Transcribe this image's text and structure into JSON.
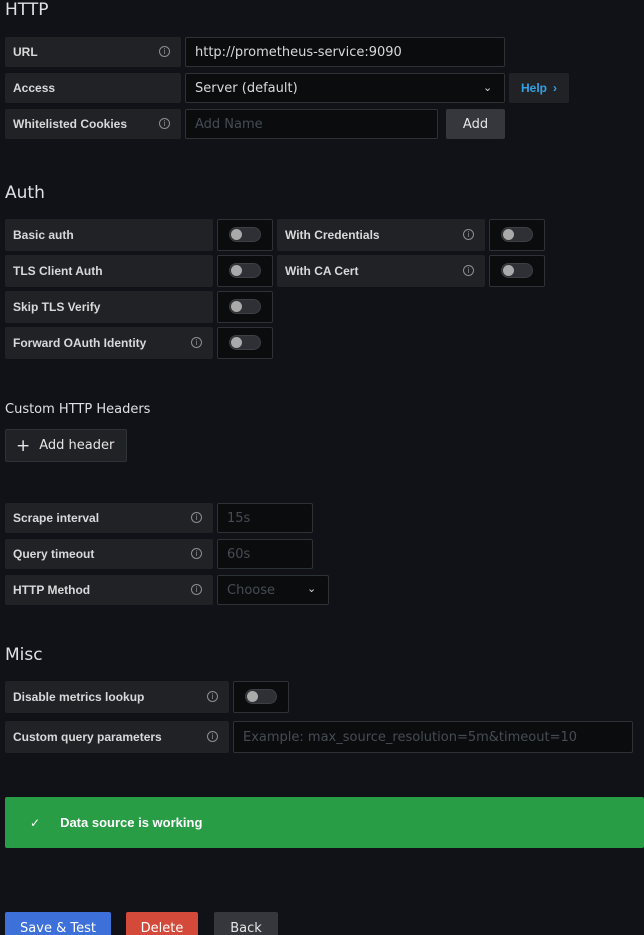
{
  "http": {
    "title": "HTTP",
    "url_label": "URL",
    "url_value": "http://prometheus-service:9090",
    "access_label": "Access",
    "access_value": "Server (default)",
    "help_label": "Help",
    "cookies_label": "Whitelisted Cookies",
    "cookies_placeholder": "Add Name",
    "add_label": "Add"
  },
  "auth": {
    "title": "Auth",
    "basic_auth": "Basic auth",
    "with_credentials": "With Credentials",
    "tls_client_auth": "TLS Client Auth",
    "with_ca_cert": "With CA Cert",
    "skip_tls_verify": "Skip TLS Verify",
    "forward_oauth": "Forward OAuth Identity"
  },
  "headers": {
    "title": "Custom HTTP Headers",
    "add_header_label": "Add header"
  },
  "prometheus": {
    "scrape_label": "Scrape interval",
    "scrape_placeholder": "15s",
    "timeout_label": "Query timeout",
    "timeout_placeholder": "60s",
    "method_label": "HTTP Method",
    "method_placeholder": "Choose"
  },
  "misc": {
    "title": "Misc",
    "disable_metrics_label": "Disable metrics lookup",
    "custom_params_label": "Custom query parameters",
    "custom_params_placeholder": "Example: max_source_resolution=5m&timeout=10"
  },
  "alert": {
    "message": "Data source is working",
    "color": "#299c46"
  },
  "actions": {
    "save_test": "Save & Test",
    "delete": "Delete",
    "back": "Back"
  },
  "colors": {
    "primary": "#3d71d9",
    "danger": "#d44a3a",
    "link": "#33a2e5"
  }
}
